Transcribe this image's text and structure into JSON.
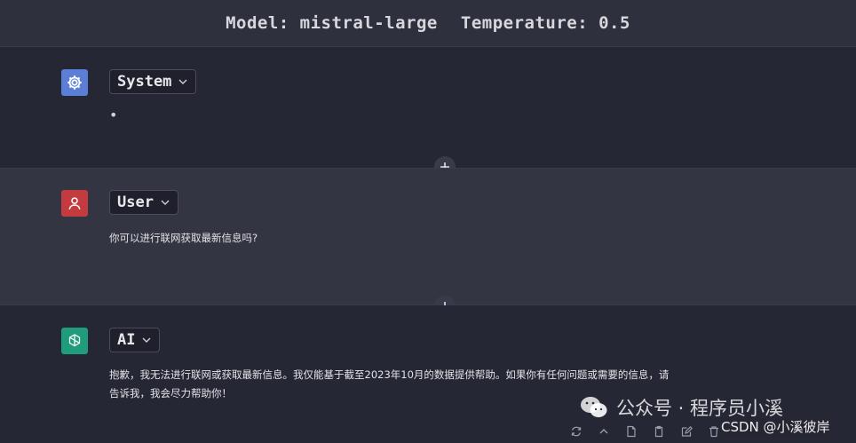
{
  "header": {
    "model_text": "Model: mistral-large",
    "temperature_text": "Temperature: 0.5"
  },
  "messages": [
    {
      "role": "System",
      "content": "•",
      "avatar_icon": "gear-icon",
      "avatar_color": "#5b7fd6"
    },
    {
      "role": "User",
      "content": "你可以进行联网获取最新信息吗?",
      "avatar_icon": "user-icon",
      "avatar_color": "#c33b3f"
    },
    {
      "role": "AI",
      "content_lines": [
        "抱歉，我无法进行联网或获取最新信息。我仅能基于截至2023年10月的数据提供帮助。如果你有任何问题或需要的信息，请",
        "告诉我，我会尽力帮助你！"
      ],
      "avatar_icon": "openai-icon",
      "avatar_color": "#1f9c7b"
    }
  ],
  "actions": {
    "add_message_icon": "plus-icon",
    "toolbar_icons": [
      "refresh-icon",
      "chevron-up-icon",
      "file-icon",
      "clipboard-icon",
      "edit-icon",
      "trash-icon"
    ]
  },
  "watermark": {
    "wechat_text": "公众号 · 程序员小溪",
    "csdn_text": "CSDN @小溪彼岸"
  }
}
